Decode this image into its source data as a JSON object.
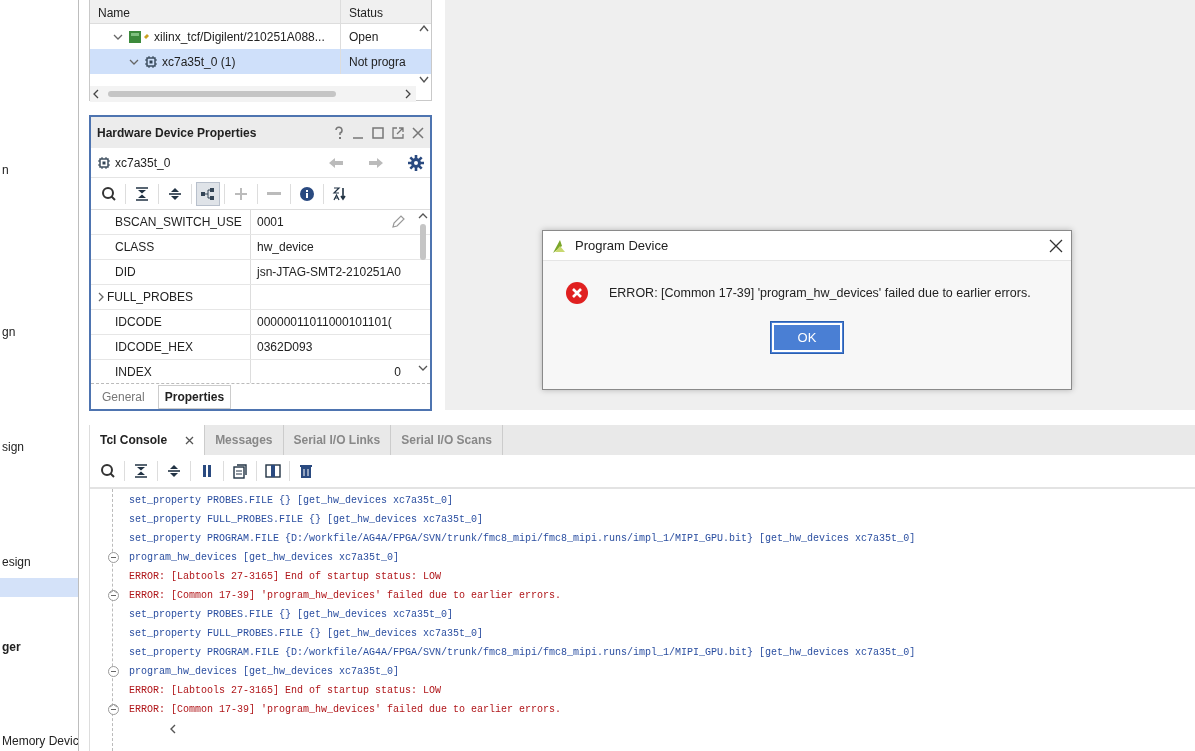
{
  "sidebar": {
    "items": [
      {
        "label": "n",
        "bold": false,
        "selected": false
      },
      {
        "label": "gn",
        "bold": false,
        "selected": false
      },
      {
        "label": "sign",
        "bold": false,
        "selected": false
      },
      {
        "label": "esign",
        "bold": false,
        "selected": false
      },
      {
        "selected": true
      },
      {
        "label": "ger",
        "bold": true,
        "selected": false
      },
      {
        "label": "Memory Devic",
        "bold": false,
        "selected": false
      }
    ]
  },
  "hardware_tree": {
    "columns": [
      "Name",
      "Status"
    ],
    "rows": [
      {
        "kind": "board",
        "label": "xilinx_tcf/Digilent/210251A088...",
        "status": "Open",
        "expanded": true,
        "selected": false,
        "children": [
          {
            "kind": "chip",
            "label": "xc7a35t_0 (1)",
            "status": "Not progra",
            "expanded": true,
            "selected": true
          }
        ]
      }
    ]
  },
  "properties_panel": {
    "title": "Hardware Device Properties",
    "object": "xc7a35t_0",
    "rows": [
      {
        "name": "BSCAN_SWITCH_USE",
        "value": "0001",
        "editable": true
      },
      {
        "name": "CLASS",
        "value": "hw_device"
      },
      {
        "name": "DID",
        "value": "jsn-JTAG-SMT2-210251A0"
      },
      {
        "name": "FULL_PROBES",
        "value": "",
        "expanded": false
      },
      {
        "name": "IDCODE",
        "value": "00000011011000101101("
      },
      {
        "name": "IDCODE_HEX",
        "value": "0362D093"
      },
      {
        "name": "INDEX",
        "value": "0",
        "kind": "number"
      }
    ],
    "tabs": [
      {
        "label": "General",
        "selected": false
      },
      {
        "label": "Properties",
        "selected": true
      }
    ]
  },
  "dialog": {
    "title": "Program Device",
    "message": "ERROR: [Common 17-39] 'program_hw_devices' failed due to earlier errors.",
    "button": "OK"
  },
  "console": {
    "tabs": [
      {
        "label": "Tcl Console",
        "selected": true,
        "closable": true
      },
      {
        "label": "Messages",
        "selected": false
      },
      {
        "label": "Serial I/O Links",
        "selected": false
      },
      {
        "label": "Serial I/O Scans",
        "selected": false
      }
    ],
    "lines": [
      {
        "kind": "command",
        "text": "set_property PROBES.FILE {} [get_hw_devices xc7a35t_0]"
      },
      {
        "kind": "command",
        "text": "set_property FULL_PROBES.FILE {} [get_hw_devices xc7a35t_0]"
      },
      {
        "kind": "command",
        "text": "set_property PROGRAM.FILE {D:/workfile/AG4A/FPGA/SVN/trunk/fmc8_mipi/fmc8_mipi.runs/impl_1/MIPI_GPU.bit} [get_hw_devices xc7a35t_0]"
      },
      {
        "kind": "command",
        "text": "program_hw_devices [get_hw_devices xc7a35t_0]",
        "fold_start": true
      },
      {
        "kind": "error",
        "text": "ERROR: [Labtools 27-3165] End of startup status: LOW"
      },
      {
        "kind": "error",
        "text": "ERROR: [Common 17-39] 'program_hw_devices' failed due to earlier errors.",
        "fold_end": true
      },
      {
        "kind": "command",
        "text": "set_property PROBES.FILE {} [get_hw_devices xc7a35t_0]"
      },
      {
        "kind": "command",
        "text": "set_property FULL_PROBES.FILE {} [get_hw_devices xc7a35t_0]"
      },
      {
        "kind": "command",
        "text": "set_property PROGRAM.FILE {D:/workfile/AG4A/FPGA/SVN/trunk/fmc8_mipi/fmc8_mipi.runs/impl_1/MIPI_GPU.bit} [get_hw_devices xc7a35t_0]"
      },
      {
        "kind": "command",
        "text": "program_hw_devices [get_hw_devices xc7a35t_0]",
        "fold_start": true
      },
      {
        "kind": "error",
        "text": "ERROR: [Labtools 27-3165] End of startup status: LOW"
      },
      {
        "kind": "error",
        "text": "ERROR: [Common 17-39] 'program_hw_devices' failed due to earlier errors.",
        "fold_end": true
      }
    ]
  }
}
